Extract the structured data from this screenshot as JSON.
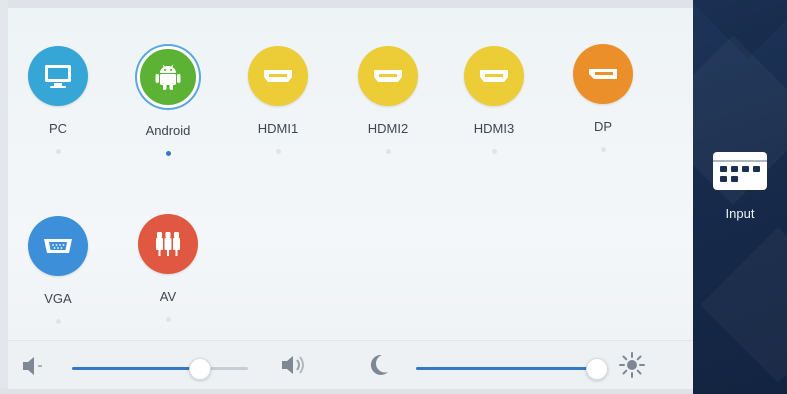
{
  "sources": [
    {
      "id": "pc",
      "label": "PC",
      "icon": "monitor-icon",
      "color": "#35a6d5",
      "selected": false
    },
    {
      "id": "android",
      "label": "Android",
      "icon": "android-icon",
      "color": "#5cb234",
      "selected": true
    },
    {
      "id": "hdmi1",
      "label": "HDMI1",
      "icon": "hdmi-port-icon",
      "color": "#eccd38",
      "selected": false
    },
    {
      "id": "hdmi2",
      "label": "HDMI2",
      "icon": "hdmi-port-icon",
      "color": "#eccd38",
      "selected": false
    },
    {
      "id": "hdmi3",
      "label": "HDMI3",
      "icon": "hdmi-port-icon",
      "color": "#eccd38",
      "selected": false
    },
    {
      "id": "dp",
      "label": "DP",
      "icon": "displayport-icon",
      "color": "#ea8f2a",
      "selected": false
    },
    {
      "id": "vga",
      "label": "VGA",
      "icon": "vga-port-icon",
      "color": "#3d8fd9",
      "selected": false
    },
    {
      "id": "av",
      "label": "AV",
      "icon": "av-rca-icon",
      "color": "#e05742",
      "selected": false
    }
  ],
  "volume": {
    "level": 0.72,
    "icon_low": "speaker-low-icon",
    "icon_high": "speaker-high-icon"
  },
  "brightness": {
    "level": 1.0,
    "icon_low": "moon-icon",
    "icon_high": "sun-icon"
  },
  "sidebar": {
    "input_label": "Input",
    "input_icon": "input-keypad-icon"
  },
  "colors": {
    "accent": "#3478c6",
    "sidebar": "#1b3053"
  }
}
